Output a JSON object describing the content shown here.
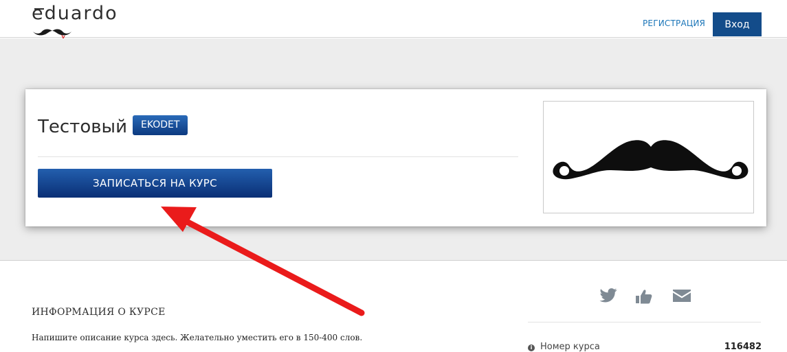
{
  "header": {
    "logo_text": "eduardo",
    "register_label": "РЕГИСТРАЦИЯ",
    "login_label": "Вход"
  },
  "course": {
    "title": "Тестовый",
    "code_badge": "EKODET",
    "enroll_label": "ЗАПИСАТЬСЯ НА КУРС",
    "image_icon": "mustache-icon"
  },
  "info": {
    "section_title": "ИНФОРМАЦИЯ О КУРСЕ",
    "description": "Напишите описание курса здесь. Желательно уместить его в 150-400 слов.",
    "course_number_label": "Номер курса",
    "course_number_value": "116482"
  },
  "social": [
    "twitter-icon",
    "like-icon",
    "mail-icon"
  ],
  "colors": {
    "primary": "#134c8a",
    "link": "#1a75b8",
    "hero_bg": "#ededed",
    "annotation_arrow": "#ea1b1b"
  }
}
